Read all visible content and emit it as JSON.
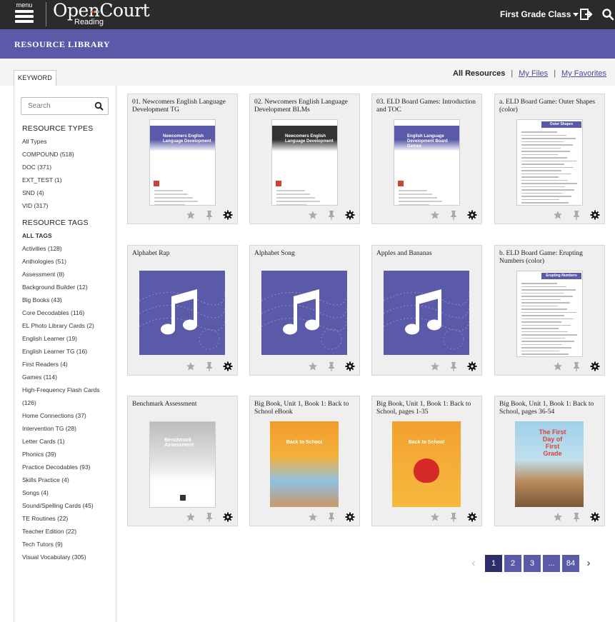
{
  "header": {
    "menu_label": "menu",
    "logo_main": "OpenCourt",
    "logo_sub": "Reading",
    "class_label": "First Grade Class",
    "logout_icon": "logout-icon",
    "search_icon": "search-icon"
  },
  "page_title": "RESOURCE LIBRARY",
  "tabs": {
    "keyword": "KEYWORD"
  },
  "views": {
    "all": "All Resources",
    "sep": "|",
    "my_files": "My Files",
    "my_favorites": "My Favorites"
  },
  "sidebar": {
    "search_placeholder": "Search",
    "types_heading": "RESOURCE TYPES",
    "types": [
      "All Types",
      "COMPOUND (518)",
      "DOC (371)",
      "EXT_TEST (1)",
      "SND (4)",
      "VID (317)"
    ],
    "tags_heading": "RESOURCE TAGS",
    "tags": [
      "ALL TAGS",
      "Activities (128)",
      "Anthologies (51)",
      "Assessment (8)",
      "Background Builder (12)",
      "Big Books (43)",
      "Core Decodables (116)",
      "EL Photo Library Cards (2)",
      "English Learner (19)",
      "English Learner TG (16)",
      "First Readers (4)",
      "Games (114)",
      "High-Frequency Flash Cards",
      "(126)",
      "Home Connections (37)",
      "Intervention TG (28)",
      "Letter Cards (1)",
      "Phonics (39)",
      "Practice Decodables (93)",
      "Skills Practice (4)",
      "Songs (4)",
      "Sound/Spelling Cards (45)",
      "TE Routines (22)",
      "Teacher Edition (22)",
      "Tech Tutors (9)",
      "Visual Vocabulary (305)"
    ]
  },
  "cards": [
    {
      "title": "01. Newcomers English Language Development TG",
      "kind": "doc",
      "band": "#5b5aa8",
      "cover": "Newcomers English Language Development"
    },
    {
      "title": "02. Newcomers English Language Development BLMs",
      "kind": "doc",
      "band": "#333333",
      "cover": "Newcomers English Language Development"
    },
    {
      "title": "03. ELD Board Games: Introduction and TOC",
      "kind": "doc",
      "band": "#5b5aa8",
      "cover": "English Language Development Board Games"
    },
    {
      "title": "a. ELD Board Game: Outer Shapes (color)",
      "kind": "text",
      "cover": "Outer Shapes"
    },
    {
      "title": "Alphabet Rap",
      "kind": "audio"
    },
    {
      "title": "Alphabet Song",
      "kind": "audio"
    },
    {
      "title": "Apples and Bananas",
      "kind": "audio"
    },
    {
      "title": "b. ELD Board Game: Erupting Numbers (color)",
      "kind": "text",
      "cover": "Erupting Numbers"
    },
    {
      "title": "Benchmark Assessment",
      "kind": "bench",
      "cover": "Benchmark Assessment"
    },
    {
      "title": "Big Book, Unit 1, Book 1: Back to School eBook",
      "kind": "book",
      "cover": "Back to School"
    },
    {
      "title": "Big Book, Unit 1, Book 1: Back to School, pages 1-35",
      "kind": "book2",
      "cover": "Back to School"
    },
    {
      "title": "Big Book, Unit 1, Book 1: Back to School, pages 36-54",
      "kind": "book3",
      "cover": "The First Day of First Grade"
    }
  ],
  "pagination": {
    "prev": "‹",
    "pages": [
      "1",
      "2",
      "3",
      "...",
      "84"
    ],
    "active": "1",
    "next": "›"
  },
  "icons": {
    "star": "star-icon",
    "pin": "pin-icon",
    "settings": "gear-icon",
    "music": "music-note-icon"
  }
}
